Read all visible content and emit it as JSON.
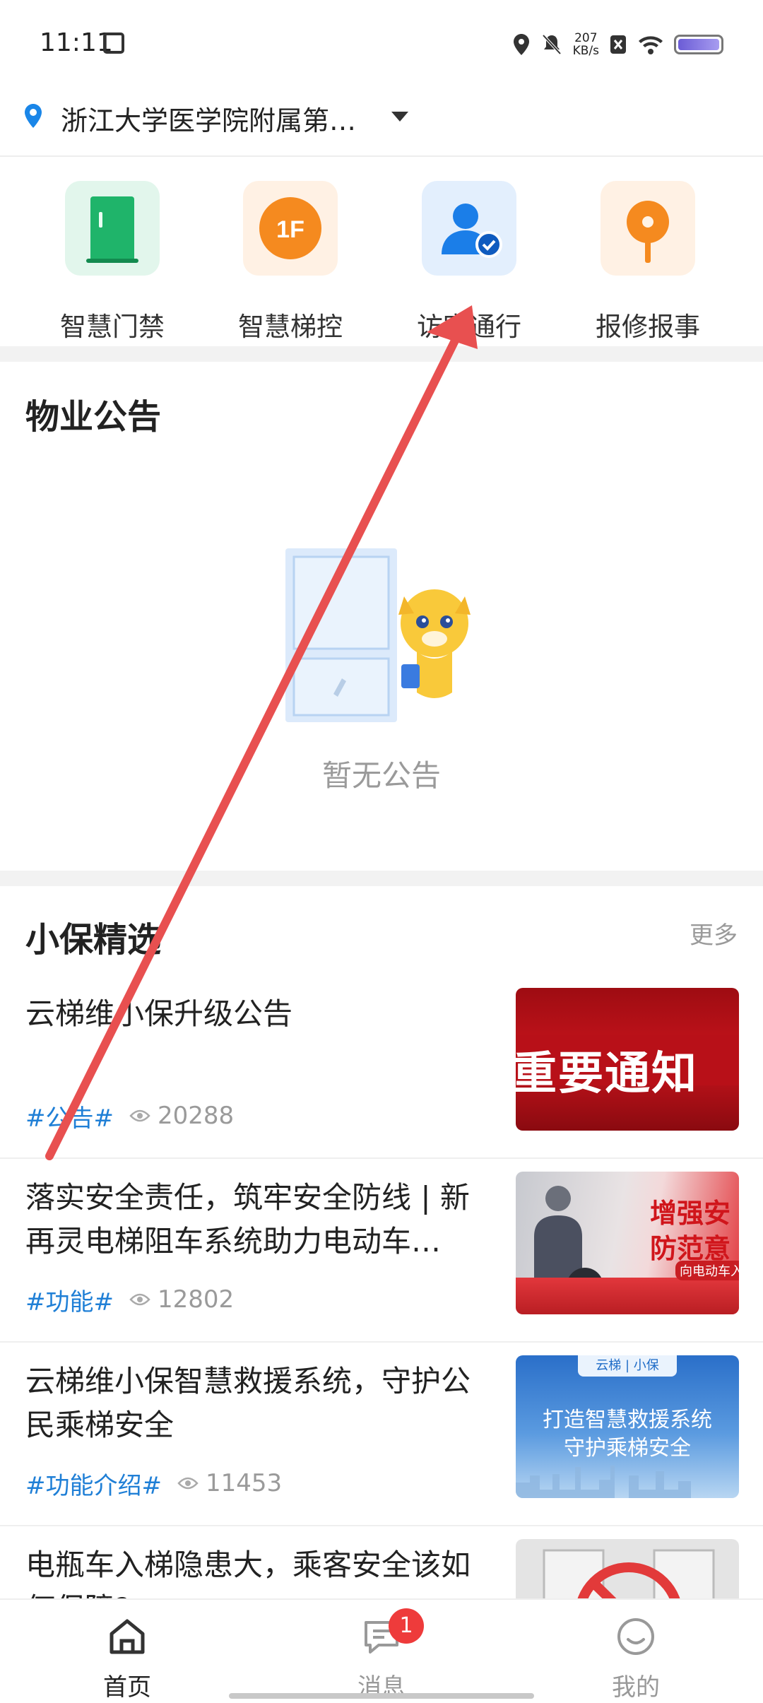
{
  "status_bar": {
    "time": "11:11",
    "speed_value": "207",
    "speed_unit": "KB/s"
  },
  "location": {
    "text": "浙江大学医学院附属第…"
  },
  "quick_actions": [
    {
      "label": "智慧门禁"
    },
    {
      "label": "智慧梯控",
      "icon_text": "1F"
    },
    {
      "label": "访客通行"
    },
    {
      "label": "报修报事"
    }
  ],
  "notices": {
    "title": "物业公告",
    "empty_text": "暂无公告"
  },
  "selection": {
    "title": "小保精选",
    "more": "更多",
    "articles": [
      {
        "title": "云梯维小保升级公告",
        "tag": "#公告#",
        "views": "20288",
        "thumb_text": "重要通知"
      },
      {
        "title": "落实安全责任，筑牢安全防线 | 新再灵电梯阻车系统助力电动车…",
        "tag": "#功能#",
        "views": "12802",
        "thumb_text1": "增强安",
        "thumb_text2": "防范意",
        "thumb_text3": "向电动车入"
      },
      {
        "title": "云梯维小保智慧救援系统，守护公民乘梯安全",
        "tag": "#功能介绍#",
        "views": "11453",
        "thumb_brand1": "云梯",
        "thumb_brand2": "小保",
        "thumb_text1": "打造智慧救援系统",
        "thumb_text2": "守护乘梯安全"
      },
      {
        "title": "电瓶车入梯隐患大，乘客安全该如何保障?"
      }
    ]
  },
  "bottom_nav": [
    {
      "label": "首页",
      "active": true
    },
    {
      "label": "消息",
      "badge": "1"
    },
    {
      "label": "我的"
    }
  ],
  "colors": {
    "accent_blue": "#1f7fd6",
    "annotation_red": "#e85050",
    "badge_red": "#ee3b3b"
  }
}
